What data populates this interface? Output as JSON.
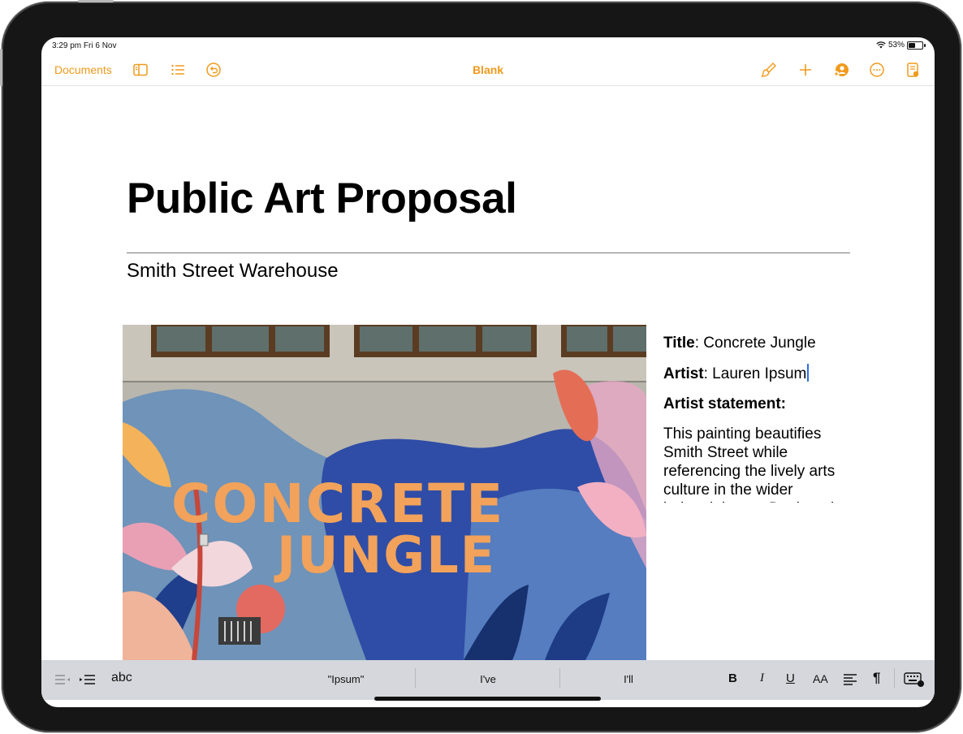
{
  "status": {
    "time": "3:29 pm  Fri 6 Nov",
    "battery": "53%",
    "battery_level": 0.53
  },
  "toolbar": {
    "documents_label": "Documents",
    "title": "Blank",
    "accent": "#f09a1c",
    "left_icons": [
      "sidebar-icon",
      "list-icon",
      "undo-icon"
    ],
    "right_icons": [
      "paintbrush-icon",
      "plus-icon",
      "collaborate-icon",
      "more-icon",
      "document-setup-icon"
    ]
  },
  "document": {
    "title": "Public Art Proposal",
    "subtitle": "Smith Street Warehouse",
    "image_text": [
      "CONCRETE",
      "JUNGLE"
    ],
    "sidebar": {
      "title_label": "Title",
      "title_value": ": Concrete Jungle",
      "artist_label": "Artist",
      "artist_value": ": Lauren Ipsum",
      "statement_heading": "Artist statement:",
      "statement_body": "This painting beautifies Smith Street while referencing the lively arts culture in the wider industrial area. Designed for both people walking on the sidewalk and those driving past in vehicles, the bright colors are positive and"
    }
  },
  "shortcut_bar": {
    "abc": "abc",
    "suggestions": [
      "\"Ipsum\"",
      "I've",
      "I'll"
    ],
    "format": {
      "bold": "B",
      "italic": "I",
      "underline": "U",
      "size": "AA",
      "pilcrow": "¶"
    },
    "icons": [
      "indent-left-icon",
      "indent-right-icon",
      "align-icon",
      "keyboard-icon"
    ]
  }
}
